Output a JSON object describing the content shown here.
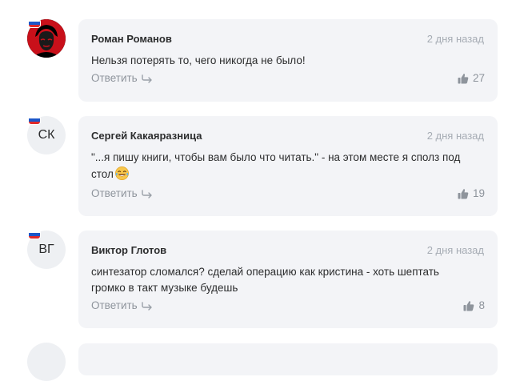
{
  "comments": [
    {
      "author": "Роман Романов",
      "date": "2 дня назад",
      "text": "Нельзя потерять то, чего никогда не было!",
      "reply_label": "Ответить",
      "likes": "27",
      "avatar_initials": ""
    },
    {
      "author": "Сергей Какаяразница",
      "date": "2 дня назад",
      "text": "\"...я пишу книги, чтобы вам было что читать.\" - на этом месте я сполз под стол",
      "reply_label": "Ответить",
      "likes": "19",
      "avatar_initials": "СК"
    },
    {
      "author": "Виктор Глотов",
      "date": "2 дня назад",
      "text": "синтезатор сломался? сделай операцию как кристина - хоть шептать громко в такт музыке будешь",
      "reply_label": "Ответить",
      "likes": "8",
      "avatar_initials": "ВГ"
    }
  ],
  "colors": {
    "card_bg": "#f3f4f7",
    "muted_text": "#8e949c",
    "date_text": "#a6acb4",
    "flag_white": "#ffffff",
    "flag_blue": "#1c57c9",
    "flag_red": "#e02a2a"
  },
  "icons": {
    "reply": "reply-arrow-icon",
    "like": "thumbs-up-icon",
    "flag": "russia-flag-icon",
    "emoji": "tears-of-joy-emoji-icon"
  }
}
